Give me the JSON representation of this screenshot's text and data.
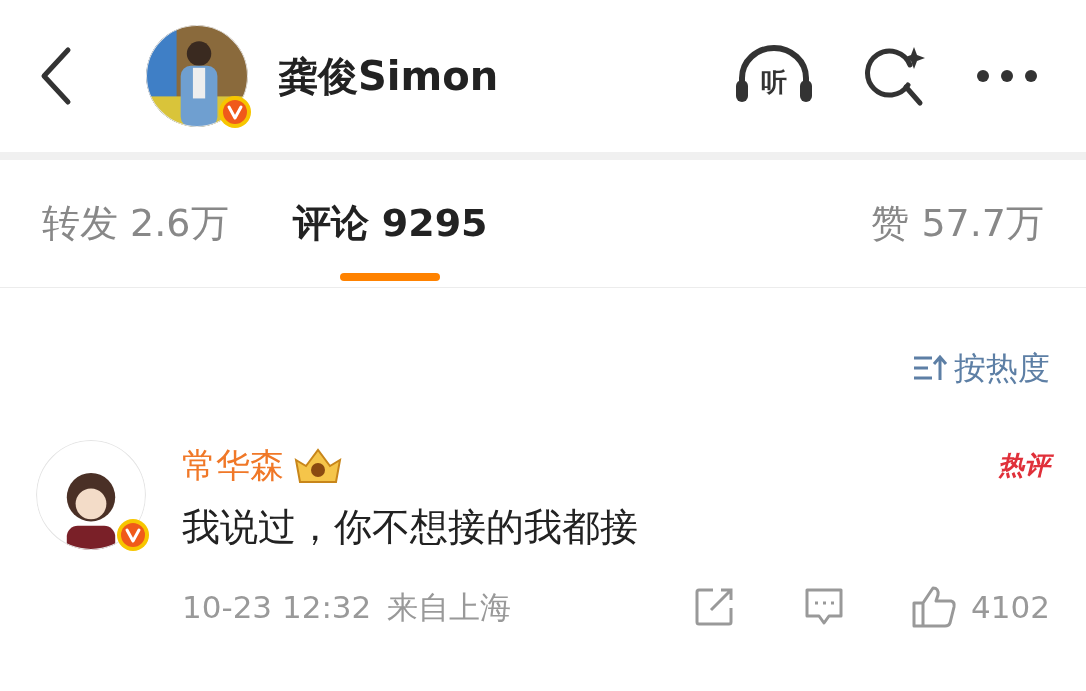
{
  "header": {
    "name": "龚俊Simon",
    "listen_label": "听"
  },
  "tabs": [
    {
      "label": "转发 2.6万",
      "selected": false
    },
    {
      "label": "评论 9295",
      "selected": true
    },
    {
      "label": "赞 57.7万",
      "selected": false
    }
  ],
  "sort": {
    "label": "按热度"
  },
  "comments": [
    {
      "author": "常华森",
      "text": "我说过，你不想接的我都接",
      "badge": "热评",
      "time": "10-23 12:32",
      "location": "来自上海",
      "likes": "4102"
    }
  ]
}
